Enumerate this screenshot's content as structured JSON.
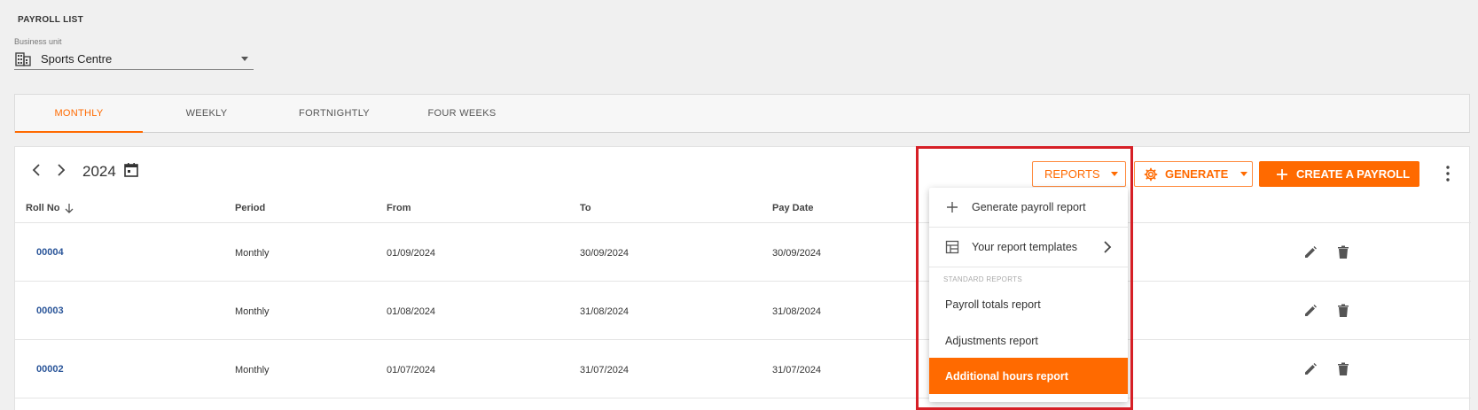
{
  "page": {
    "title": "PAYROLL LIST"
  },
  "business_unit": {
    "label": "Business unit",
    "value": "Sports Centre"
  },
  "tabs": [
    {
      "label": "MONTHLY",
      "active": true
    },
    {
      "label": "WEEKLY",
      "active": false
    },
    {
      "label": "FORTNIGHTLY",
      "active": false
    },
    {
      "label": "FOUR WEEKS",
      "active": false
    }
  ],
  "toolbar": {
    "year": "2024",
    "reports_label": "REPORTS",
    "generate_label": "GENERATE",
    "create_label": "CREATE A PAYROLL"
  },
  "table": {
    "headers": {
      "roll_no": "Roll No",
      "period": "Period",
      "from": "From",
      "to": "To",
      "pay_date": "Pay Date"
    },
    "rows": [
      {
        "roll_no": "00004",
        "period": "Monthly",
        "from": "01/09/2024",
        "to": "30/09/2024",
        "pay_date": "30/09/2024"
      },
      {
        "roll_no": "00003",
        "period": "Monthly",
        "from": "01/08/2024",
        "to": "31/08/2024",
        "pay_date": "31/08/2024"
      },
      {
        "roll_no": "00002",
        "period": "Monthly",
        "from": "01/07/2024",
        "to": "31/07/2024",
        "pay_date": "31/07/2024"
      }
    ]
  },
  "reports_menu": {
    "generate": "Generate payroll report",
    "templates": "Your report templates",
    "section": "STANDARD REPORTS",
    "items": [
      "Payroll totals report",
      "Adjustments report",
      "Additional hours report"
    ]
  },
  "colors": {
    "accent": "#ff6a00",
    "link": "#2a5599",
    "highlight": "#d61f26"
  }
}
